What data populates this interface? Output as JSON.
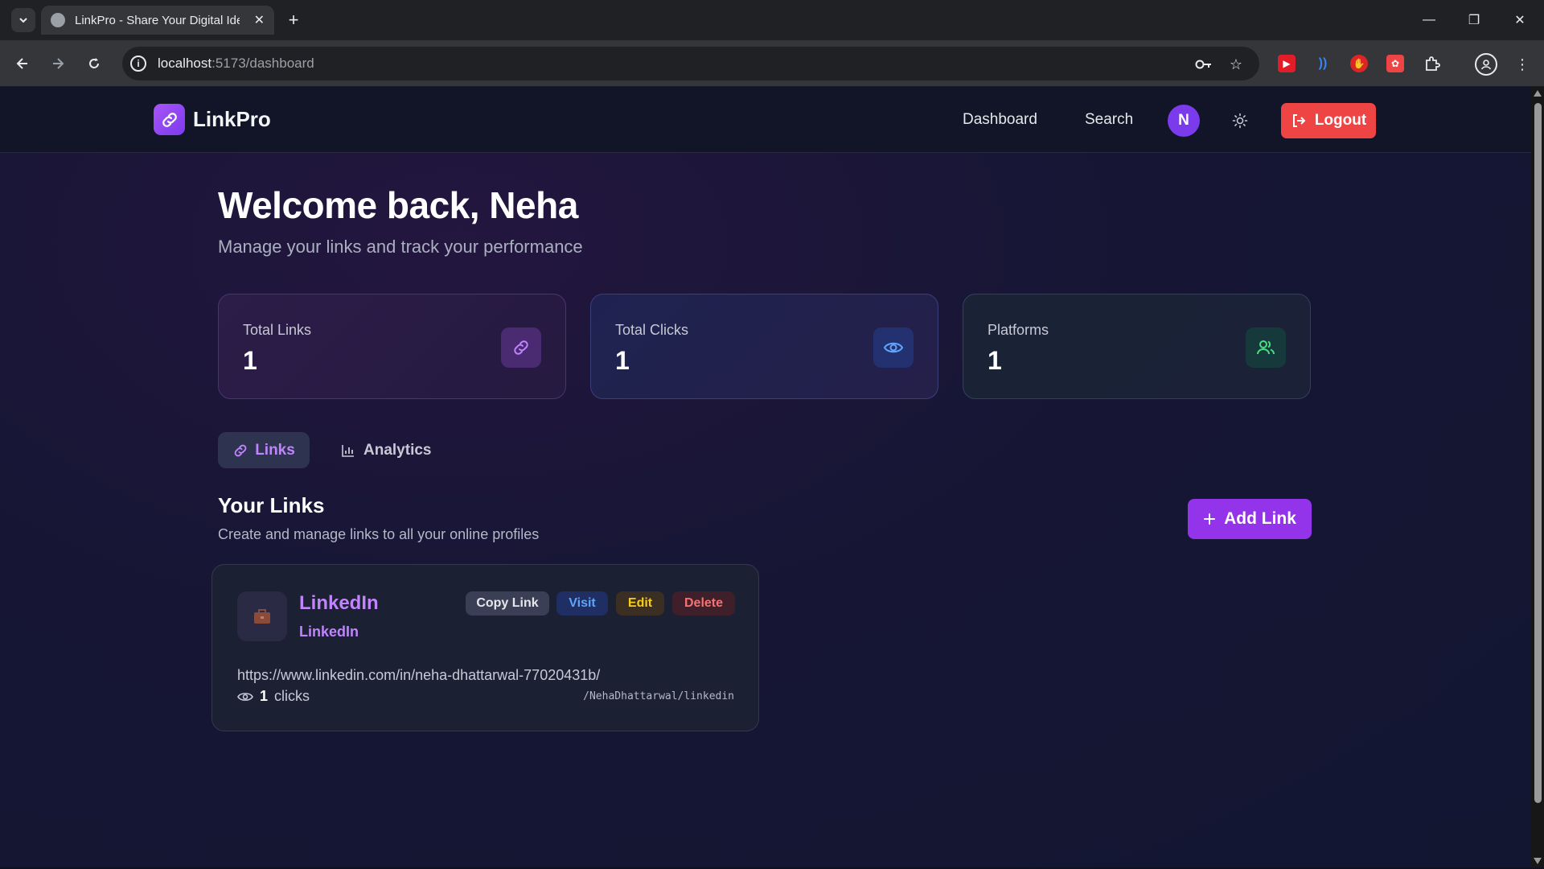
{
  "browser": {
    "tab_title": "LinkPro - Share Your Digital Ide",
    "url_host": "localhost",
    "url_path": ":5173/dashboard"
  },
  "header": {
    "brand": "LinkPro",
    "nav": [
      "Dashboard",
      "Search"
    ],
    "avatar_initial": "N",
    "logout_label": "Logout"
  },
  "welcome": {
    "title": "Welcome back, Neha",
    "subtitle": "Manage your links and track your performance"
  },
  "stats": [
    {
      "label": "Total Links",
      "value": "1",
      "icon": "link-icon"
    },
    {
      "label": "Total Clicks",
      "value": "1",
      "icon": "eye-icon"
    },
    {
      "label": "Platforms",
      "value": "1",
      "icon": "users-icon"
    }
  ],
  "tabs": [
    {
      "label": "Links",
      "active": true
    },
    {
      "label": "Analytics",
      "active": false
    }
  ],
  "links_section": {
    "title": "Your Links",
    "subtitle": "Create and manage links to all your online profiles",
    "add_label": "Add Link"
  },
  "links": [
    {
      "name": "LinkedIn",
      "platform": "LinkedIn",
      "url": "https://www.linkedin.com/in/neha-dhattarwal-77020431b/",
      "clicks": "1",
      "clicks_label": "clicks",
      "slug": "/NehaDhattarwal/linkedin",
      "actions": [
        "Copy Link",
        "Visit",
        "Edit",
        "Delete"
      ]
    }
  ],
  "colors": {
    "accent": "#9333ea",
    "logout": "#ef4444",
    "link_text": "#c084fc"
  }
}
